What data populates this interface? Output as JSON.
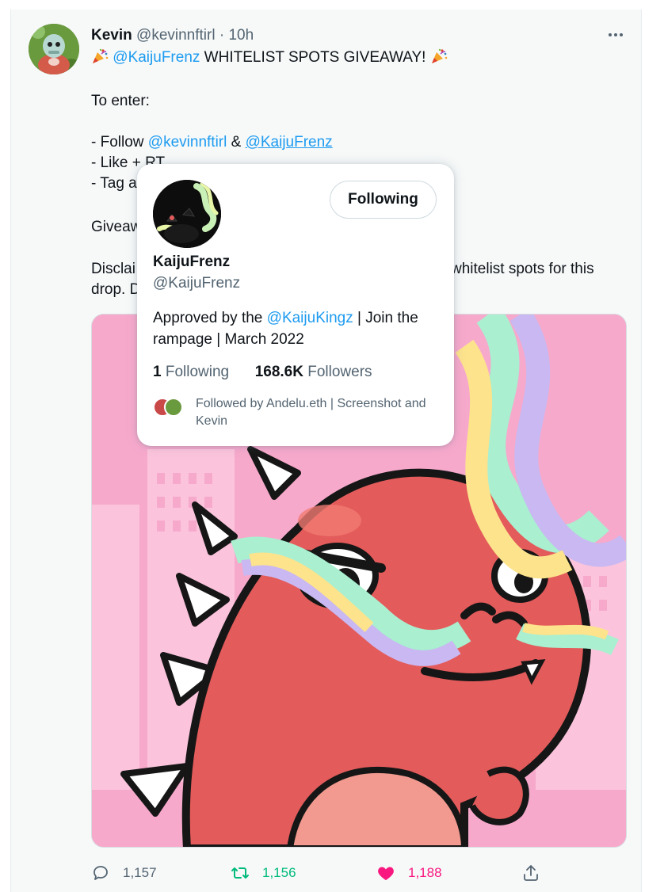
{
  "tweet": {
    "author_name": "Kevin",
    "author_handle": "@kevinnftirl",
    "separator": "·",
    "time": "10h",
    "line1_mention": "@KaijuFrenz",
    "line1_text": " WHITELIST SPOTS GIVEAWAY! ",
    "to_enter": "To enter:",
    "follow_prefix": "- Follow ",
    "follow_mention1": "@kevinnftirl",
    "follow_amp": " & ",
    "follow_mention2": "@KaijuFrenz",
    "like_rt": "- Like + RT",
    "tag": "- Tag a",
    "giveaway": "Giveaw",
    "disclaimer_start": "Disclai",
    "disclaimer_right": "whitelist spots for this",
    "drop": "drop. D"
  },
  "actions": {
    "replies": "1,157",
    "retweets": "1,156",
    "likes": "1,188"
  },
  "hovercard": {
    "follow_button": "Following",
    "name": "KaijuFrenz",
    "handle": "@KaijuFrenz",
    "bio_prefix": "Approved by the ",
    "bio_mention": "@KaijuKingz",
    "bio_suffix": " | Join the",
    "bio_line2": "rampage | March 2022",
    "following_count": "1",
    "following_label": " Following",
    "followers_count": "168.6K",
    "followers_label": " Followers",
    "followed_by": "Followed by Andelu.eth | Screenshot and Kevin"
  },
  "colors": {
    "link": "#1d9bf0",
    "retweet": "#00ba7c",
    "like": "#f91880",
    "secondary": "#536471"
  },
  "icons": [
    "more-icon",
    "party-popper-icon",
    "reply-icon",
    "retweet-icon",
    "like-icon",
    "share-icon"
  ]
}
